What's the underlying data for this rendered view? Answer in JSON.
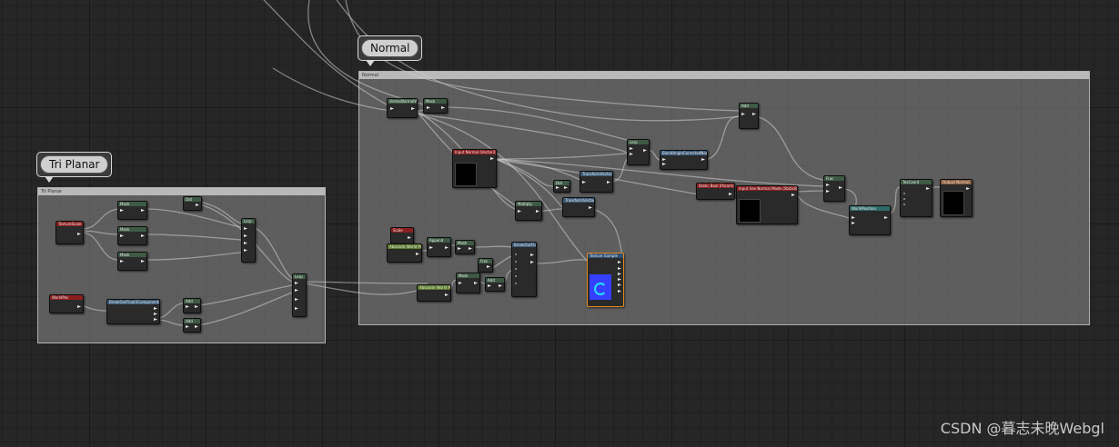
{
  "comments": {
    "normal": {
      "header": "Normal",
      "bubble": "Normal"
    },
    "triplanar": {
      "header": "Tri Planar",
      "bubble": "Tri Planar"
    }
  },
  "nodes": {
    "texture_sample": {
      "title": "Texture Sample"
    },
    "vertex_normal_ws": {
      "title": "VertexNormalWS"
    },
    "input_normal": {
      "title": "Input Normal (Vector3)"
    },
    "transform_vector": {
      "title": "TransformVector"
    },
    "blend_angle_corrected": {
      "title": "BlendAngleCorrectedNormals"
    },
    "static_bool": {
      "title": "Static Bool (Param)"
    },
    "input_use_normal": {
      "title": "Input Use Normal Mode (StaticBool)"
    },
    "world_pos": {
      "title": "WorldPosition"
    },
    "texture_coordinate": {
      "title": "TexCoord"
    },
    "output": {
      "title": "Output Normal"
    },
    "scale_param": {
      "title": "Scale"
    },
    "absolute_world_pos": {
      "title": "Absolute World Position"
    },
    "append": {
      "title": "Append"
    },
    "mask": {
      "title": "Mask"
    },
    "lerp": {
      "title": "Lerp"
    },
    "add": {
      "title": "Add"
    },
    "multiply": {
      "title": "Multiply"
    },
    "dot": {
      "title": "Dot"
    },
    "fraction": {
      "title": "Frac"
    },
    "break_out": {
      "title": "BreakOutFloat3Components"
    },
    "tp_scale": {
      "title": "TextureScale"
    },
    "tp_world": {
      "title": "WorldPos"
    }
  },
  "watermark": "CSDN @暮志未晚Webgl"
}
